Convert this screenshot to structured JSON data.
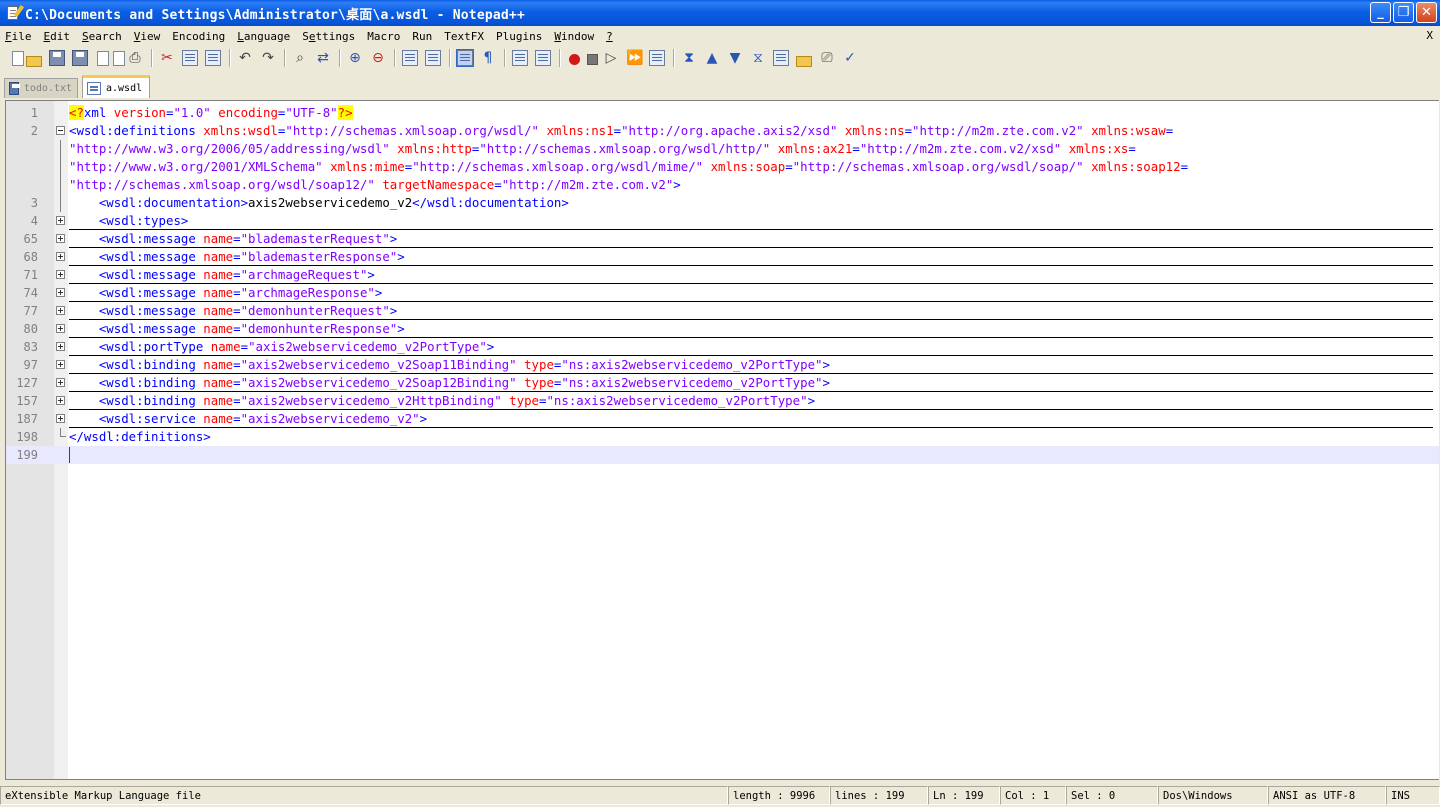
{
  "window": {
    "title": "C:\\Documents and Settings\\Administrator\\桌面\\a.wsdl - Notepad++",
    "minimize": "_",
    "maximize": "❐",
    "close": "✕"
  },
  "menu": {
    "items": [
      {
        "u": "F",
        "rest": "ile"
      },
      {
        "u": "E",
        "rest": "dit"
      },
      {
        "u": "S",
        "rest": "earch"
      },
      {
        "u": "V",
        "rest": "iew"
      },
      {
        "pre": "Encoding"
      },
      {
        "u": "L",
        "rest": "anguage"
      },
      {
        "pre": "S",
        "u": "e",
        "rest": "ttings"
      },
      {
        "pre": "Macro"
      },
      {
        "pre": "Run"
      },
      {
        "pre": "TextFX"
      },
      {
        "pre": "Plugins"
      },
      {
        "u": "W",
        "rest": "indow"
      },
      {
        "u": "?",
        "rest": ""
      }
    ],
    "close_doc": "X"
  },
  "tabs": [
    {
      "label": "todo.txt",
      "active": false
    },
    {
      "label": "a.wsdl",
      "active": true
    }
  ],
  "editor": {
    "lines": [
      {
        "num": "1",
        "fold": "none",
        "segs": [
          [
            "pi",
            "<?"
          ],
          [
            "tg",
            "xml "
          ],
          [
            "at",
            "version"
          ],
          [
            "tg",
            "="
          ],
          [
            "vl",
            "\"1.0\""
          ],
          [
            "tg",
            " "
          ],
          [
            "at",
            "encoding"
          ],
          [
            "tg",
            "="
          ],
          [
            "vl",
            "\"UTF-8\""
          ],
          [
            "pi",
            "?>"
          ]
        ]
      },
      {
        "num": "2",
        "fold": "open",
        "segs": [
          [
            "tg",
            "<wsdl:definitions "
          ],
          [
            "at",
            "xmlns:wsdl"
          ],
          [
            "tg",
            "="
          ],
          [
            "vl",
            "\"http://schemas.xmlsoap.org/wsdl/\""
          ],
          [
            "tg",
            " "
          ],
          [
            "at",
            "xmlns:ns1"
          ],
          [
            "tg",
            "="
          ],
          [
            "vl",
            "\"http://org.apache.axis2/xsd\""
          ],
          [
            "tg",
            " "
          ],
          [
            "at",
            "xmlns:ns"
          ],
          [
            "tg",
            "="
          ],
          [
            "vl",
            "\"http://m2m.zte.com.v2\""
          ],
          [
            "tg",
            " "
          ],
          [
            "at",
            "xmlns:wsaw"
          ],
          [
            "tg",
            "="
          ]
        ]
      },
      {
        "num": "",
        "fold": "line",
        "segs": [
          [
            "vl",
            "\"http://www.w3.org/2006/05/addressing/wsdl\""
          ],
          [
            "tg",
            " "
          ],
          [
            "at",
            "xmlns:http"
          ],
          [
            "tg",
            "="
          ],
          [
            "vl",
            "\"http://schemas.xmlsoap.org/wsdl/http/\""
          ],
          [
            "tg",
            " "
          ],
          [
            "at",
            "xmlns:ax21"
          ],
          [
            "tg",
            "="
          ],
          [
            "vl",
            "\"http://m2m.zte.com.v2/xsd\""
          ],
          [
            "tg",
            " "
          ],
          [
            "at",
            "xmlns:xs"
          ],
          [
            "tg",
            "="
          ]
        ]
      },
      {
        "num": "",
        "fold": "line",
        "segs": [
          [
            "vl",
            "\"http://www.w3.org/2001/XMLSchema\""
          ],
          [
            "tg",
            " "
          ],
          [
            "at",
            "xmlns:mime"
          ],
          [
            "tg",
            "="
          ],
          [
            "vl",
            "\"http://schemas.xmlsoap.org/wsdl/mime/\""
          ],
          [
            "tg",
            " "
          ],
          [
            "at",
            "xmlns:soap"
          ],
          [
            "tg",
            "="
          ],
          [
            "vl",
            "\"http://schemas.xmlsoap.org/wsdl/soap/\""
          ],
          [
            "tg",
            " "
          ],
          [
            "at",
            "xmlns:soap12"
          ],
          [
            "tg",
            "="
          ]
        ]
      },
      {
        "num": "",
        "fold": "line",
        "segs": [
          [
            "vl",
            "\"http://schemas.xmlsoap.org/wsdl/soap12/\""
          ],
          [
            "tg",
            " "
          ],
          [
            "at",
            "targetNamespace"
          ],
          [
            "tg",
            "="
          ],
          [
            "vl",
            "\"http://m2m.zte.com.v2\""
          ],
          [
            "tg",
            ">"
          ]
        ]
      },
      {
        "num": "3",
        "fold": "line",
        "segs": [
          [
            "tx",
            "    "
          ],
          [
            "tg",
            "<wsdl:documentation>"
          ],
          [
            "tx",
            "axis2webservicedemo_v2"
          ],
          [
            "tg",
            "</wsdl:documentation>"
          ]
        ]
      },
      {
        "num": "4",
        "fold": "plus",
        "segs": [
          [
            "tx",
            "    "
          ],
          [
            "tg",
            "<wsdl:types>"
          ]
        ]
      },
      {
        "num": "65",
        "fold": "plus",
        "segs": [
          [
            "tx",
            "    "
          ],
          [
            "tg",
            "<wsdl:message "
          ],
          [
            "at",
            "name"
          ],
          [
            "tg",
            "="
          ],
          [
            "vl",
            "\"blademasterRequest\""
          ],
          [
            "tg",
            ">"
          ]
        ]
      },
      {
        "num": "68",
        "fold": "plus",
        "segs": [
          [
            "tx",
            "    "
          ],
          [
            "tg",
            "<wsdl:message "
          ],
          [
            "at",
            "name"
          ],
          [
            "tg",
            "="
          ],
          [
            "vl",
            "\"blademasterResponse\""
          ],
          [
            "tg",
            ">"
          ]
        ]
      },
      {
        "num": "71",
        "fold": "plus",
        "segs": [
          [
            "tx",
            "    "
          ],
          [
            "tg",
            "<wsdl:message "
          ],
          [
            "at",
            "name"
          ],
          [
            "tg",
            "="
          ],
          [
            "vl",
            "\"archmageRequest\""
          ],
          [
            "tg",
            ">"
          ]
        ]
      },
      {
        "num": "74",
        "fold": "plus",
        "segs": [
          [
            "tx",
            "    "
          ],
          [
            "tg",
            "<wsdl:message "
          ],
          [
            "at",
            "name"
          ],
          [
            "tg",
            "="
          ],
          [
            "vl",
            "\"archmageResponse\""
          ],
          [
            "tg",
            ">"
          ]
        ]
      },
      {
        "num": "77",
        "fold": "plus",
        "segs": [
          [
            "tx",
            "    "
          ],
          [
            "tg",
            "<wsdl:message "
          ],
          [
            "at",
            "name"
          ],
          [
            "tg",
            "="
          ],
          [
            "vl",
            "\"demonhunterRequest\""
          ],
          [
            "tg",
            ">"
          ]
        ]
      },
      {
        "num": "80",
        "fold": "plus",
        "segs": [
          [
            "tx",
            "    "
          ],
          [
            "tg",
            "<wsdl:message "
          ],
          [
            "at",
            "name"
          ],
          [
            "tg",
            "="
          ],
          [
            "vl",
            "\"demonhunterResponse\""
          ],
          [
            "tg",
            ">"
          ]
        ]
      },
      {
        "num": "83",
        "fold": "plus",
        "segs": [
          [
            "tx",
            "    "
          ],
          [
            "tg",
            "<wsdl:portType "
          ],
          [
            "at",
            "name"
          ],
          [
            "tg",
            "="
          ],
          [
            "vl",
            "\"axis2webservicedemo_v2PortType\""
          ],
          [
            "tg",
            ">"
          ]
        ]
      },
      {
        "num": "97",
        "fold": "plus",
        "segs": [
          [
            "tx",
            "    "
          ],
          [
            "tg",
            "<wsdl:binding "
          ],
          [
            "at",
            "name"
          ],
          [
            "tg",
            "="
          ],
          [
            "vl",
            "\"axis2webservicedemo_v2Soap11Binding\""
          ],
          [
            "tg",
            " "
          ],
          [
            "at",
            "type"
          ],
          [
            "tg",
            "="
          ],
          [
            "vl",
            "\"ns:axis2webservicedemo_v2PortType\""
          ],
          [
            "tg",
            ">"
          ]
        ]
      },
      {
        "num": "127",
        "fold": "plus",
        "segs": [
          [
            "tx",
            "    "
          ],
          [
            "tg",
            "<wsdl:binding "
          ],
          [
            "at",
            "name"
          ],
          [
            "tg",
            "="
          ],
          [
            "vl",
            "\"axis2webservicedemo_v2Soap12Binding\""
          ],
          [
            "tg",
            " "
          ],
          [
            "at",
            "type"
          ],
          [
            "tg",
            "="
          ],
          [
            "vl",
            "\"ns:axis2webservicedemo_v2PortType\""
          ],
          [
            "tg",
            ">"
          ]
        ]
      },
      {
        "num": "157",
        "fold": "plus",
        "segs": [
          [
            "tx",
            "    "
          ],
          [
            "tg",
            "<wsdl:binding "
          ],
          [
            "at",
            "name"
          ],
          [
            "tg",
            "="
          ],
          [
            "vl",
            "\"axis2webservicedemo_v2HttpBinding\""
          ],
          [
            "tg",
            " "
          ],
          [
            "at",
            "type"
          ],
          [
            "tg",
            "="
          ],
          [
            "vl",
            "\"ns:axis2webservicedemo_v2PortType\""
          ],
          [
            "tg",
            ">"
          ]
        ]
      },
      {
        "num": "187",
        "fold": "plus",
        "segs": [
          [
            "tx",
            "    "
          ],
          [
            "tg",
            "<wsdl:service "
          ],
          [
            "at",
            "name"
          ],
          [
            "tg",
            "="
          ],
          [
            "vl",
            "\"axis2webservicedemo_v2\""
          ],
          [
            "tg",
            ">"
          ]
        ]
      },
      {
        "num": "198",
        "fold": "end",
        "segs": [
          [
            "tg",
            "</wsdl:definitions>"
          ]
        ]
      },
      {
        "num": "199",
        "fold": "none",
        "segs": [],
        "current": true
      }
    ]
  },
  "status": {
    "file_type": "eXtensible Markup Language file",
    "length": "length : 9996",
    "lines": "lines : 199",
    "ln": "Ln : 199",
    "col": "Col : 1",
    "sel": "Sel : 0",
    "eol": "Dos\\Windows",
    "encoding": "ANSI as UTF-8",
    "mode": "INS"
  },
  "colors": {
    "tag": "#0000ff",
    "attribute": "#ff0000",
    "value": "#8000ff",
    "pi_background": "#ffff00",
    "current_line": "#e8e8ff"
  }
}
